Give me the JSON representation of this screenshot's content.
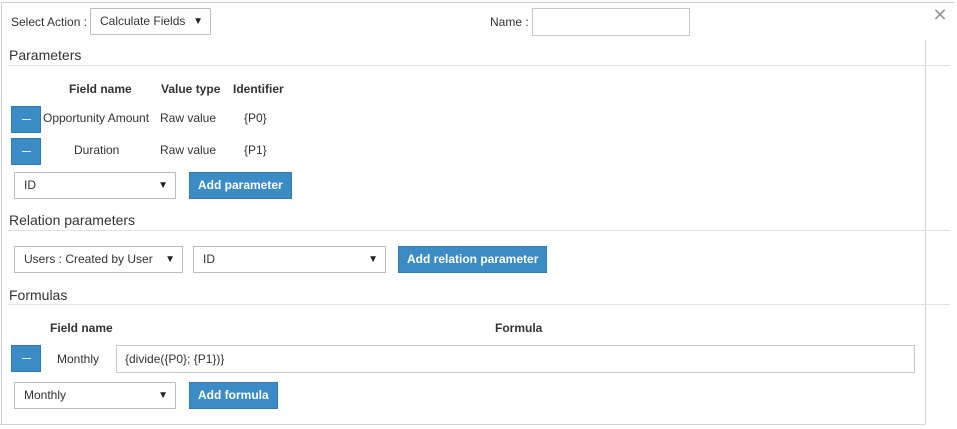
{
  "header": {
    "select_action_label": "Select Action :",
    "select_action_value": "Calculate Fields",
    "name_label": "Name :",
    "name_value": ""
  },
  "icons": {
    "close": "close-icon",
    "dropdown": "chevron-down-icon",
    "remove": "minus-icon"
  },
  "colors": {
    "button_bg": "#3b8cc4",
    "border": "#bdbdbd"
  },
  "parameters": {
    "title": "Parameters",
    "columns": [
      "Field name",
      "Value type",
      "Identifier"
    ],
    "rows": [
      {
        "field": "Opportunity Amount",
        "value_type": "Raw value",
        "identifier": "{P0}"
      },
      {
        "field": "Duration",
        "value_type": "Raw value",
        "identifier": "{P1}"
      }
    ],
    "add_select_value": "ID",
    "add_button": "Add parameter"
  },
  "relation_parameters": {
    "title": "Relation parameters",
    "relation_select_value": "Users : Created by User",
    "field_select_value": "ID",
    "add_button": "Add relation parameter"
  },
  "formulas": {
    "title": "Formulas",
    "columns": [
      "Field name",
      "Formula"
    ],
    "rows": [
      {
        "field": "Monthly",
        "formula": "{divide({P0}; {P1})}"
      }
    ],
    "add_select_value": "Monthly",
    "add_button": "Add formula"
  }
}
